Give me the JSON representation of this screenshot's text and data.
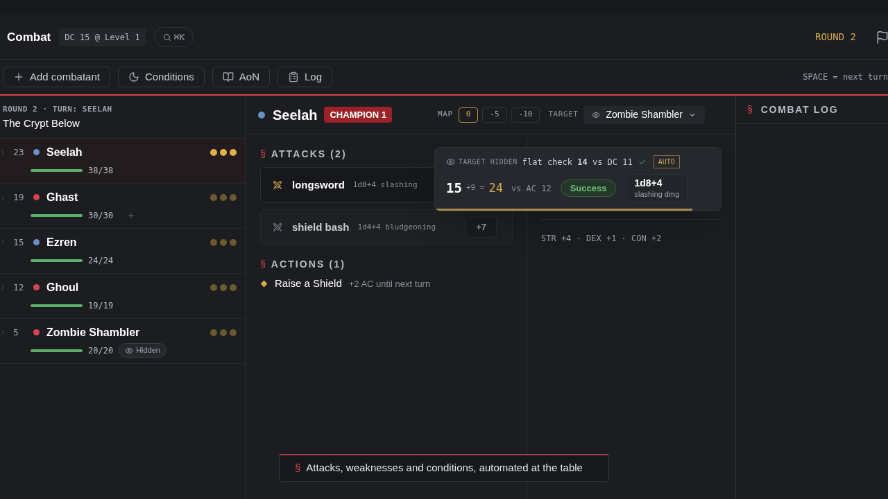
{
  "header": {
    "title": "Combat",
    "dc_badge": "DC 15 @ Level 1",
    "search_hint": "⌘K",
    "round": "ROUND 2"
  },
  "toolbar": {
    "buttons": [
      {
        "label": "Add combatant",
        "kind": "plus"
      },
      {
        "label": "Conditions",
        "kind": "moon"
      },
      {
        "label": "AoN",
        "kind": "book"
      },
      {
        "label": "Log",
        "kind": "clipboard"
      }
    ],
    "hint": "SPACE = next turn"
  },
  "tracker": {
    "status": "ROUND 2 · TURN: SEELAH",
    "encounter": "The Crypt Below",
    "combatants": [
      {
        "initiative": "23",
        "name": "Seelah",
        "color": "#6b8fc7",
        "hp": "38/38",
        "level": 1,
        "selected": true,
        "add_button": false
      },
      {
        "initiative": "19",
        "name": "Ghast",
        "color": "#d9434d",
        "hp": "30/30",
        "level": 1,
        "selected": false,
        "add_button": true
      },
      {
        "initiative": "15",
        "name": "Ezren",
        "color": "#6b8fc7",
        "hp": "24/24",
        "level": 1,
        "selected": false,
        "add_button": false
      },
      {
        "initiative": "12",
        "name": "Ghoul",
        "color": "#d9434d",
        "hp": "19/19",
        "level": 1,
        "selected": false,
        "add_button": false
      },
      {
        "initiative": "5",
        "name": "Zombie Shambler",
        "color": "#d9434d",
        "hp": "20/20",
        "level": 1,
        "selected": false,
        "add_button": false,
        "badge": "Hidden"
      }
    ]
  },
  "detail": {
    "name": "Seelah",
    "color": "#6b8fc7",
    "class_badge": "CHAMPION 1",
    "map_label": "MAP",
    "map_options": [
      {
        "label": "0",
        "selected": true
      },
      {
        "label": "-5",
        "selected": false
      },
      {
        "label": "-10",
        "selected": false
      }
    ],
    "target_label": "TARGET",
    "target": "Zombie Shambler",
    "attacks_marker": "§",
    "attacks_heading": "ATTACKS (2)",
    "attacks": [
      {
        "name": "longsword",
        "damage": "1d8+4 slashing",
        "selected": true
      },
      {
        "name": "shield bash",
        "damage": "1d4+4 bludgeoning",
        "bonus": "+7",
        "selected": false
      }
    ],
    "actions_marker": "§",
    "actions_heading": "ACTIONS (1)",
    "actions": [
      {
        "name": "Raise a Shield",
        "note": "+2 AC until next turn"
      }
    ],
    "abilities": "STR +4 · DEX +1 · CON +2"
  },
  "roll_popup": {
    "hidden_label": "TARGET HIDDEN",
    "flat_check": "flat check **14** vs DC 11",
    "auto": "AUTO",
    "die": "15",
    "modifier": "+9 =",
    "total": "24",
    "vs": "vs AC 12",
    "result": "Success",
    "damage": "1d8+4",
    "damage_type": "slashing dmg",
    "level": 0.9
  },
  "combat_log": {
    "marker": "§",
    "title": "COMBAT LOG"
  },
  "toast": {
    "marker": "§",
    "text": "Attacks, weaknesses and conditions, automated at the table"
  }
}
